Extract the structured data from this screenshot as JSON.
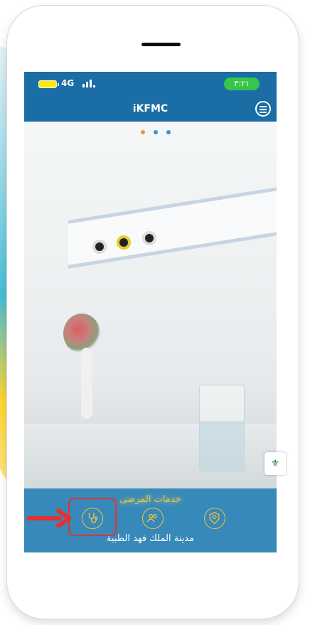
{
  "status_bar": {
    "network": "4G",
    "time": "٣:٢١"
  },
  "nav": {
    "title": "iKFMC"
  },
  "carousel": {
    "dots": [
      "#f0952b",
      "#2a9ad8",
      "#2a9ad8"
    ]
  },
  "bottom_panel": {
    "section_title": "خدمات المرضى",
    "hospital_name": "مدينة الملك فهد الطبية",
    "tabs": [
      {
        "icon": "stethoscope-icon"
      },
      {
        "icon": "users-icon"
      },
      {
        "icon": "hexagon-user-icon"
      }
    ]
  },
  "colors": {
    "primary": "#1b6ea5",
    "accent": "#f2c33e",
    "highlight": "#e53030",
    "battery": "#ffeb00",
    "clock_pill": "#35c64b"
  }
}
